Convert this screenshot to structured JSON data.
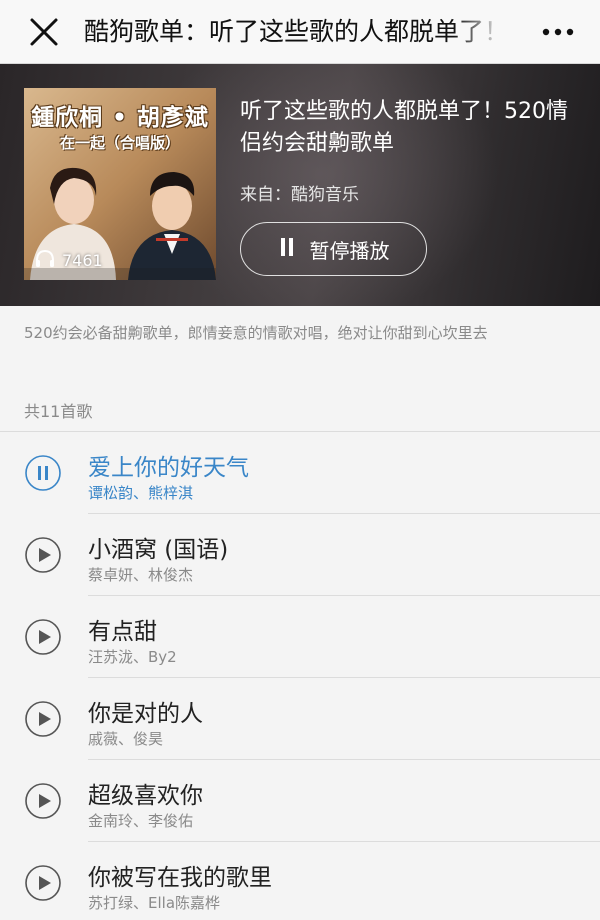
{
  "navbar": {
    "title": "酷狗歌单：听了这些歌的人都脱单了！"
  },
  "hero": {
    "cover_line1": "鍾欣桐 • 胡彥斌",
    "cover_line2": "在一起（合唱版）",
    "listen_count": "7461",
    "title": "听了这些歌的人都脱单了！520情侣约会甜齁歌单",
    "source": "来自：酷狗音乐",
    "pause_label": "暂停播放"
  },
  "description": "520约会必备甜齁歌单，郎情妾意的情歌对唱，绝对让你甜到心坎里去",
  "song_count": "共11首歌",
  "songs": [
    {
      "title": "爱上你的好天气",
      "artist": "谭松韵、熊梓淇",
      "state": "playing"
    },
    {
      "title": "小酒窝 (国语)",
      "artist": "蔡卓妍、林俊杰",
      "state": "idle"
    },
    {
      "title": "有点甜",
      "artist": "汪苏泷、By2",
      "state": "idle"
    },
    {
      "title": "你是对的人",
      "artist": "戚薇、俊昊",
      "state": "idle"
    },
    {
      "title": "超级喜欢你",
      "artist": "金南玲、李俊佑",
      "state": "idle"
    },
    {
      "title": "你被写在我的歌里",
      "artist": "苏打绿、Ella陈嘉桦",
      "state": "idle"
    }
  ],
  "colors": {
    "accent": "#3a86c8",
    "icon_gray": "#555555"
  },
  "icons": {
    "close": "close-icon",
    "more": "more-icon",
    "headphones": "headphones-icon",
    "pause": "pause-icon",
    "play": "play-icon"
  }
}
